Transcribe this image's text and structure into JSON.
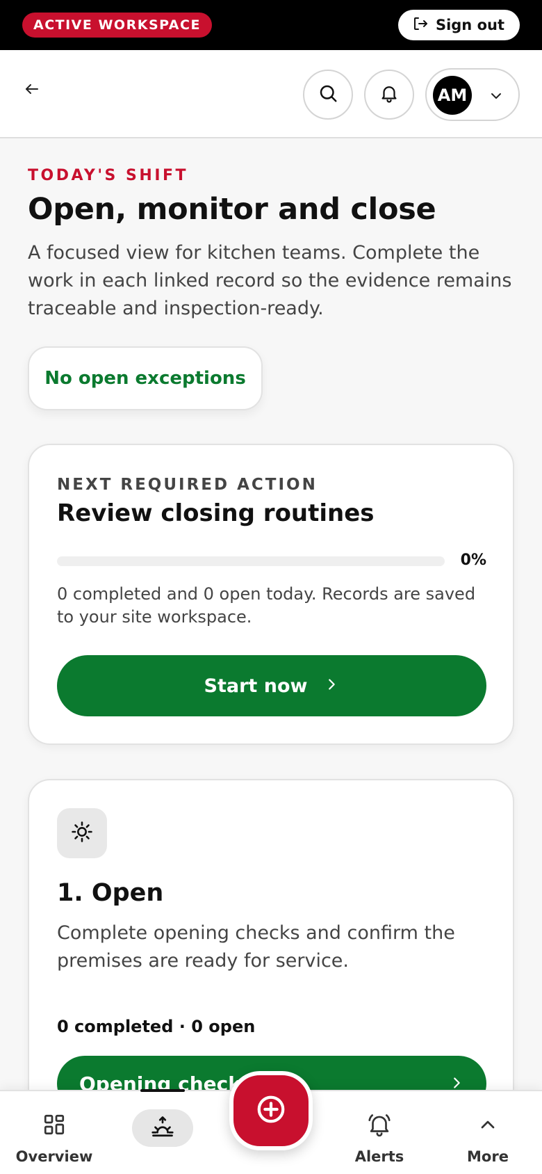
{
  "topbar": {
    "workspace_badge": "ACTIVE WORKSPACE",
    "signout_label": "Sign out",
    "signout_icon": "sign-out-icon"
  },
  "header": {
    "back_icon": "arrow-left-icon",
    "search_icon": "search-icon",
    "notifications_icon": "bell-icon",
    "user_initials": "AM",
    "user_menu_icon": "chevron-down-icon"
  },
  "hero": {
    "eyebrow": "TODAY'S SHIFT",
    "title": "Open, monitor and close",
    "lead": "A focused view for kitchen teams. Complete the work in each linked record so the evidence remains traceable and inspection-ready.",
    "exceptions_label": "No open exceptions"
  },
  "next_action": {
    "eyebrow": "NEXT REQUIRED ACTION",
    "title": "Review closing routines",
    "progress_fraction": 0,
    "progress_label": "0%",
    "note": "0 completed and 0 open today. Records are saved to your site workspace.",
    "button_label": "Start now",
    "button_icon": "chevron-right-icon"
  },
  "phase_open": {
    "icon": "sun-icon",
    "title": "1. Open",
    "description": "Complete opening checks and confirm the premises are ready for service.",
    "counts": "0 completed · 0 open",
    "button_label": "Opening checks",
    "button_icon": "chevron-right-icon"
  },
  "bottom_nav": {
    "overview_label": "Overview",
    "overview_icon": "grid-icon",
    "shift_icon": "sunrise-icon",
    "fab_icon": "plus-circle-icon",
    "alerts_label": "Alerts",
    "alerts_icon": "bell-ringing-icon",
    "more_label": "More",
    "more_icon": "chevron-up-icon"
  },
  "colors": {
    "brand_red": "#c8102e",
    "success_green": "#0b7a2f",
    "black": "#000000"
  }
}
